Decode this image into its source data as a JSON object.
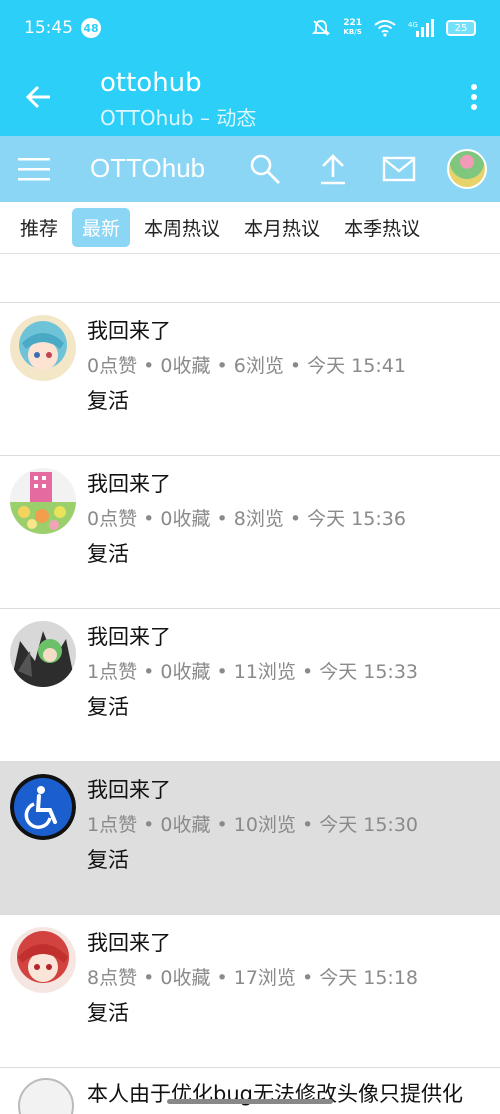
{
  "status_bar": {
    "time": "15:45",
    "notification_count": "48",
    "net_speed_value": "221",
    "net_speed_unit": "KB/S",
    "battery": "25"
  },
  "app_bar": {
    "title": "ottohub",
    "subtitle": "OTTOhub – 动态"
  },
  "web_toolbar": {
    "brand": "OTTOhub"
  },
  "tabs": [
    {
      "label": "推荐",
      "active": false
    },
    {
      "label": "最新",
      "active": true
    },
    {
      "label": "本周热议",
      "active": false
    },
    {
      "label": "本月热议",
      "active": false
    },
    {
      "label": "本季热议",
      "active": false
    }
  ],
  "posts": [
    {
      "title": "我回来了",
      "meta": "0点赞 • 0收藏 • 6浏览 • 今天 15:41",
      "body": "复活",
      "avatar": "blue-hair-girl",
      "highlight": false
    },
    {
      "title": "我回来了",
      "meta": "0点赞 • 0收藏 • 8浏览 • 今天 15:36",
      "body": "复活",
      "avatar": "pink-building-crowd",
      "highlight": false
    },
    {
      "title": "我回来了",
      "meta": "1点赞 • 0收藏 • 11浏览 • 今天 15:33",
      "body": "复活",
      "avatar": "green-hair-dark",
      "highlight": false
    },
    {
      "title": "我回来了",
      "meta": "1点赞 • 0收藏 • 10浏览 • 今天 15:30",
      "body": "复活",
      "avatar": "wheelchair-symbol",
      "highlight": true
    },
    {
      "title": "我回来了",
      "meta": "8点赞 • 0收藏 • 17浏览 • 今天 15:18",
      "body": "复活",
      "avatar": "red-hair-girl",
      "highlight": false
    }
  ],
  "partial_post": {
    "title": "本人由于优化bug无法修改头像只提供化"
  },
  "colors": {
    "primary": "#2ccff7",
    "toolbar": "#8cd6f5",
    "highlight_row": "#dedede",
    "meta_text": "#8a8a8a"
  }
}
